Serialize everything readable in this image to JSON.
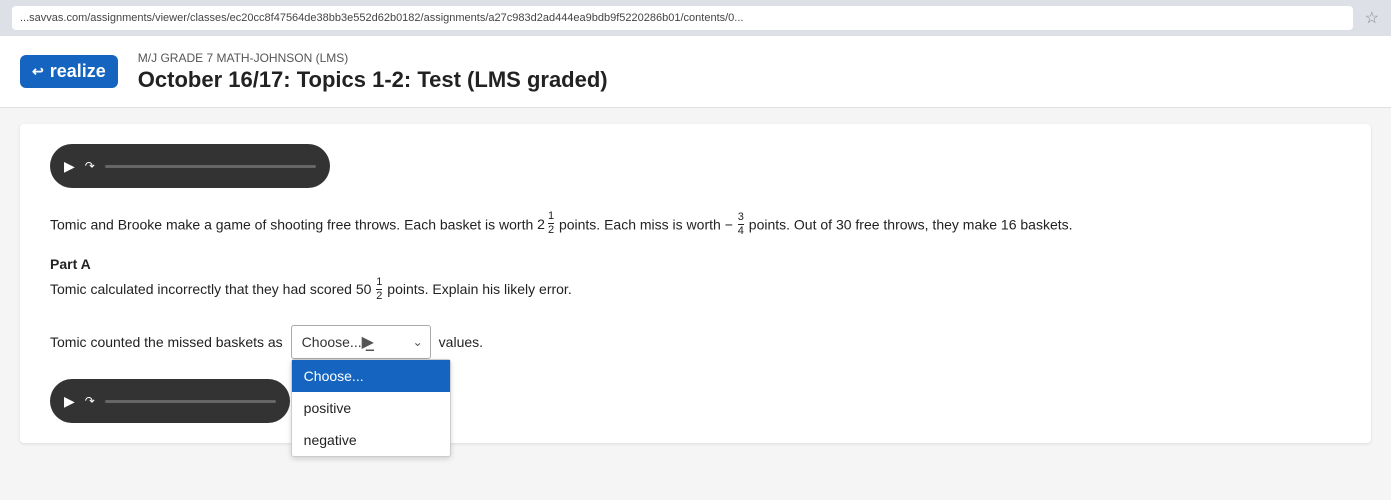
{
  "browser": {
    "url": "...savvas.com/assignments/viewer/classes/ec20cc8f47564de38bb3e552d62b0182/assignments/a27c983d2ad444ea9bdb9f5220286b01/contents/0...",
    "star_icon": "☆"
  },
  "header": {
    "logo_text": "realize",
    "logo_icon": "↩",
    "subtitle": "M/J GRADE 7 MATH-JOHNSON (LMS)",
    "title": "October 16/17: Topics 1-2: Test (LMS graded)"
  },
  "content": {
    "question_text": "Tomic and Brooke make a game of shooting free throws. Each basket is worth 2",
    "basket_whole": "2",
    "basket_num": "1",
    "basket_den": "2",
    "worth_label": "worth",
    "points_label": "points. Each miss is worth",
    "miss_neg": "−",
    "miss_num": "3",
    "miss_den": "4",
    "points2_label": "points. Out of 30 free throws, they make 16 baskets.",
    "part_label": "Part A",
    "sub_question": "Tomic calculated incorrectly that they had scored 50",
    "sub_num": "1",
    "sub_den": "2",
    "sub_rest": "points. Explain his likely error.",
    "answer_prefix": "Tomic counted the missed baskets as",
    "answer_suffix": "values.",
    "dropdown": {
      "placeholder": "Choose...",
      "selected": "Choose...",
      "options": [
        {
          "label": "Choose...",
          "active": true
        },
        {
          "label": "positive",
          "active": false
        },
        {
          "label": "negative",
          "active": false
        }
      ]
    }
  }
}
